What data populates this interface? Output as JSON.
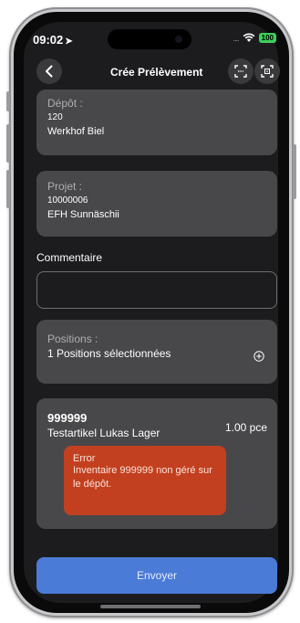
{
  "status_bar": {
    "time": "09:02",
    "battery": "100"
  },
  "header": {
    "title": "Crée Prélèvement"
  },
  "depot": {
    "label": "Dépôt :",
    "code": "120",
    "name": "Werkhof Biel"
  },
  "projet": {
    "label": "Projet :",
    "code": "10000006",
    "name": "EFH Sunnäschii"
  },
  "commentaire": {
    "label": "Commentaire",
    "value": ""
  },
  "positions": {
    "label": "Positions :",
    "summary": "1 Positions sélectionnées"
  },
  "article": {
    "code": "999999",
    "name": "Testartikel Lukas Lager",
    "quantity": "1.00 pce"
  },
  "error": {
    "title": "Error",
    "message": "Inventaire 999999 non géré sur le dépôt."
  },
  "footer": {
    "submit_label": "Envoyer"
  },
  "colors": {
    "background": "#1c1c1e",
    "card": "#48484a",
    "error": "#c2401f",
    "primary": "#4a7bd6",
    "battery": "#3fcf5a"
  }
}
